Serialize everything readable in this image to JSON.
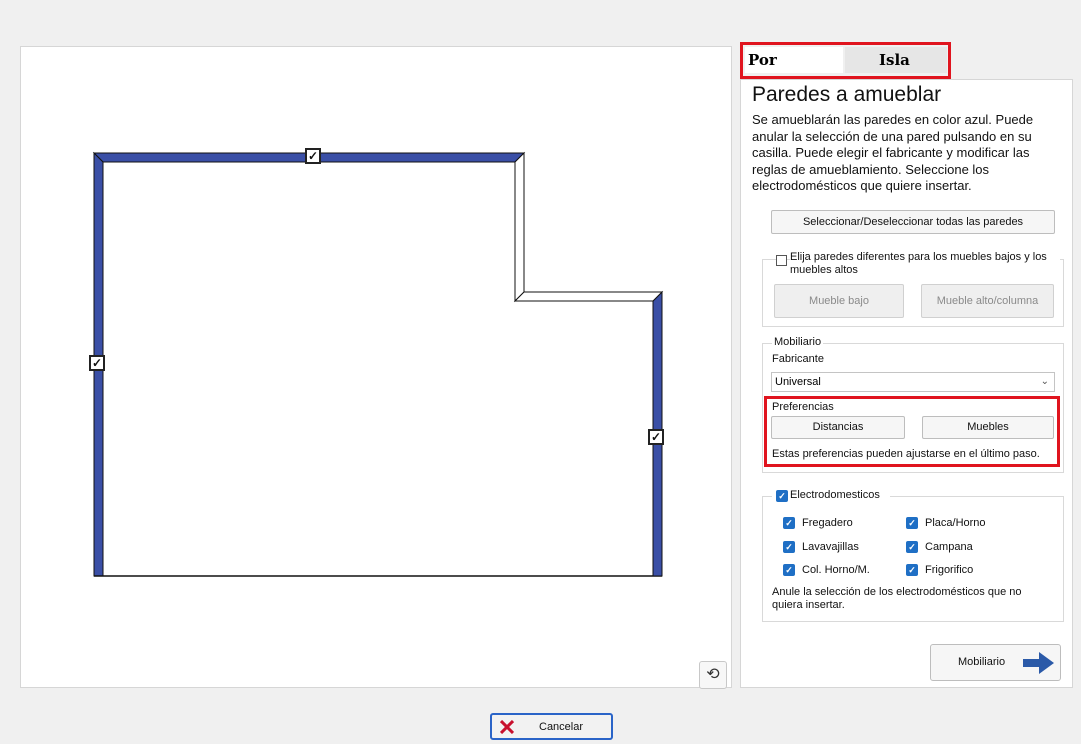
{
  "tabs": {
    "active": "Por paredes",
    "inactive": "Isla"
  },
  "title": "Paredes a amueblar",
  "description": "Se amueblarán las paredes en color azul. Puede anular la selección de una pared pulsando en su casilla. Puede elegir el fabricante y modificar las reglas de amueblamiento. Seleccione los electrodomésticos que quiere insertar.",
  "select_all_button": "Seleccionar/Deseleccionar todas las paredes",
  "different_walls": {
    "checked": false,
    "label": "Elija paredes diferentes para los muebles bajos y los muebles altos",
    "low_button": "Mueble bajo",
    "high_button": "Mueble alto/columna"
  },
  "mobiliario": {
    "legend": "Mobiliario",
    "manufacturer_label": "Fabricante",
    "manufacturer_value": "Universal",
    "preferences_label": "Preferencias",
    "distances_button": "Distancias",
    "furniture_button": "Muebles",
    "note": "Estas preferencias pueden ajustarse en el último paso."
  },
  "appliances": {
    "legend": "Electrodomesticos",
    "checked": true,
    "items": [
      {
        "label": "Fregadero",
        "checked": true
      },
      {
        "label": "Placa/Horno",
        "checked": true
      },
      {
        "label": "Lavavajillas",
        "checked": true
      },
      {
        "label": "Campana",
        "checked": true
      },
      {
        "label": "Col. Horno/M.",
        "checked": true
      },
      {
        "label": "Frigorifico",
        "checked": true
      }
    ],
    "note": "Anule la selección de los electrodomésticos que no quiera insertar."
  },
  "next_button": "Mobiliario",
  "cancel_button": "Cancelar",
  "wall_checks": [
    "✓",
    "✓",
    "✓"
  ],
  "colors": {
    "wall_active": "#3a4fa6",
    "highlight": "#e0141e",
    "cancel_x": "#c8102e",
    "arrow": "#2b5aa8"
  },
  "icons": {
    "refresh": "refresh-icon",
    "next": "arrow-right-icon",
    "cancel": "close-icon"
  }
}
